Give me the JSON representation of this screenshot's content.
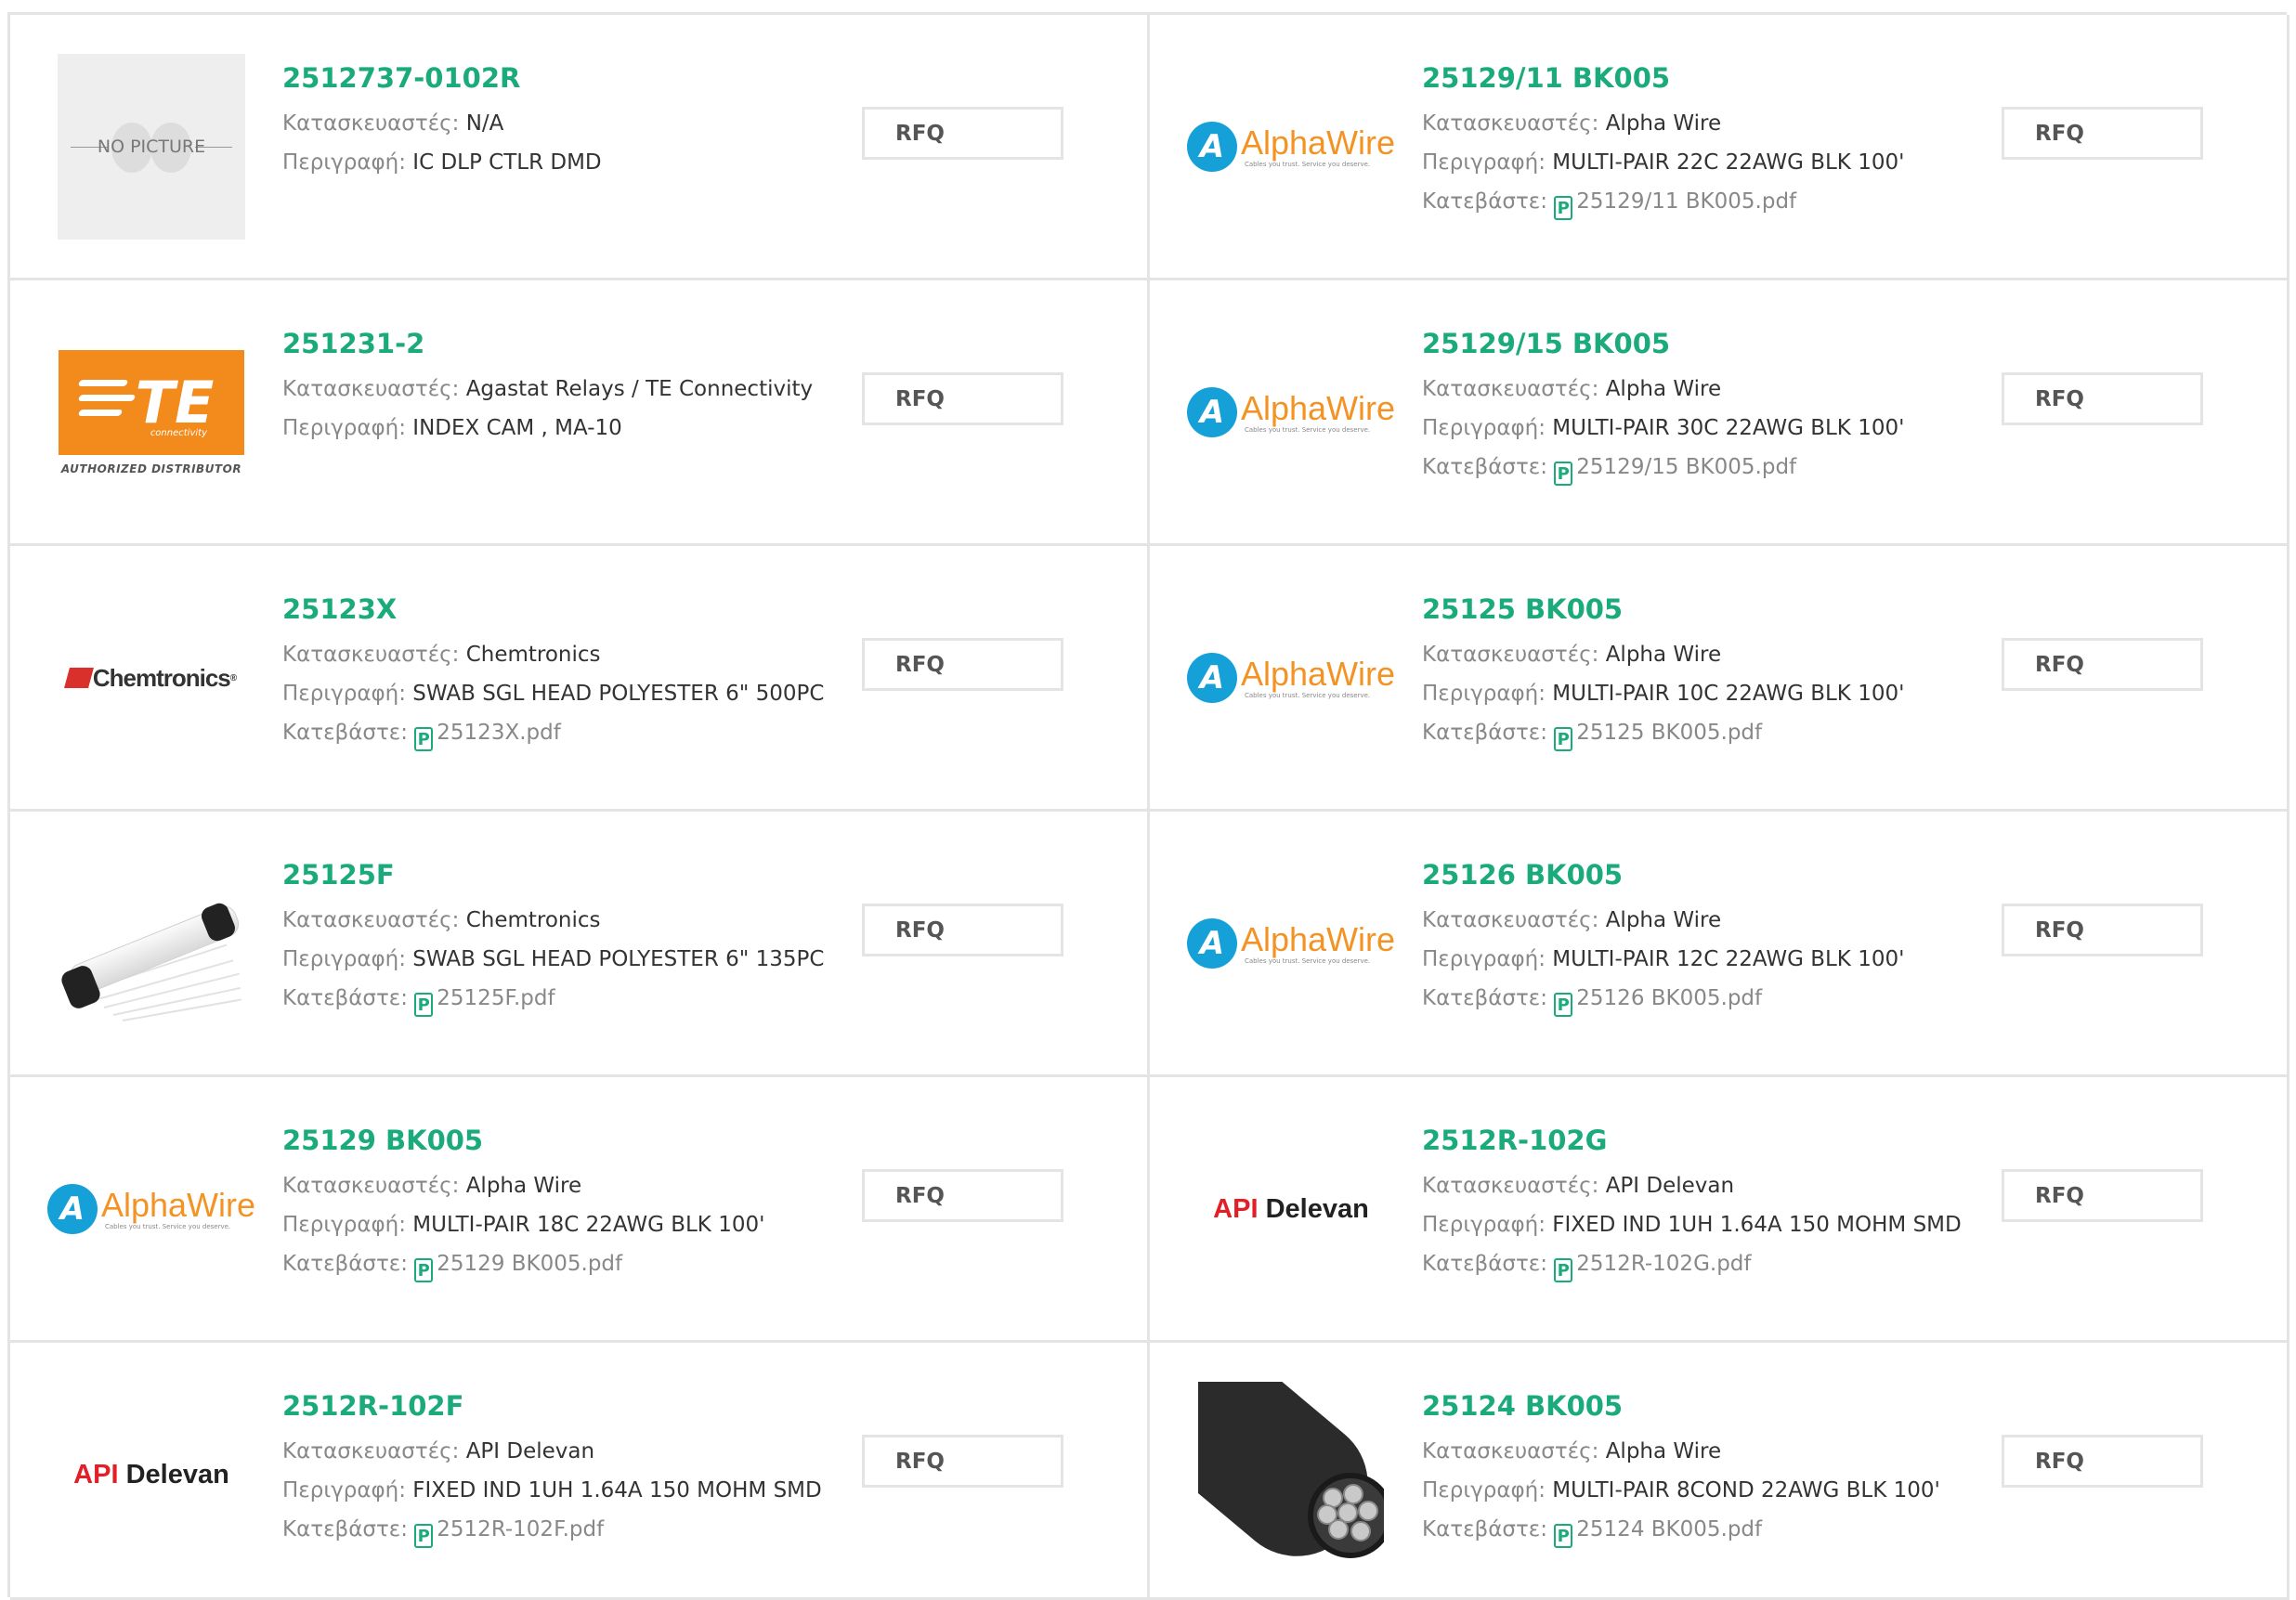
{
  "labels": {
    "manufacturer": "Κατασκευαστές:",
    "description": "Περιγραφή:",
    "download": "Κατεβάστε:",
    "rfq": "RFQ",
    "pdf_icon": "P"
  },
  "logos": {
    "no_picture": "NO PICTURE",
    "te": "TE",
    "te_sub": "connectivity",
    "te_authorized": "AUTHORIZED DISTRIBUTOR",
    "chemtronics": "Chemtronics",
    "chemtronics_mark": "®",
    "alpha_letter": "A",
    "alphawire": "AlphaWire",
    "alphawire_tagline": "Cables you trust. Service you deserve.",
    "api_red": "API",
    "api_dark": "Delevan"
  },
  "colors": {
    "accent": "#1aaa7c",
    "border": "#e4e4e4",
    "label": "#888888",
    "te_orange": "#f28a1c",
    "alpha_blue": "#15a1d8",
    "alpha_orange": "#f39323",
    "api_red": "#e21f26"
  },
  "products": [
    {
      "part": "2512737-0102R",
      "manufacturer": "N/A",
      "description": "IC DLP CTLR DMD",
      "pdf": null,
      "image": "no-picture"
    },
    {
      "part": "25129/11 BK005",
      "manufacturer": "Alpha Wire",
      "description": "MULTI-PAIR 22C 22AWG BLK 100'",
      "pdf": "25129/11 BK005.pdf",
      "image": "alphawire-logo"
    },
    {
      "part": "251231-2",
      "manufacturer": "Agastat Relays / TE Connectivity",
      "description": "INDEX CAM , MA-10",
      "pdf": null,
      "image": "te-logo"
    },
    {
      "part": "25129/15 BK005",
      "manufacturer": "Alpha Wire",
      "description": "MULTI-PAIR 30C 22AWG BLK 100'",
      "pdf": "25129/15 BK005.pdf",
      "image": "alphawire-logo"
    },
    {
      "part": "25123X",
      "manufacturer": "Chemtronics",
      "description": "SWAB SGL HEAD POLYESTER 6\" 500PC",
      "pdf": "25123X.pdf",
      "image": "chemtronics-logo"
    },
    {
      "part": "25125 BK005",
      "manufacturer": "Alpha Wire",
      "description": "MULTI-PAIR 10C 22AWG BLK 100'",
      "pdf": "25125 BK005.pdf",
      "image": "alphawire-logo"
    },
    {
      "part": "25125F",
      "manufacturer": "Chemtronics",
      "description": "SWAB SGL HEAD POLYESTER 6\" 135PC",
      "pdf": "25125F.pdf",
      "image": "swab-photo"
    },
    {
      "part": "25126 BK005",
      "manufacturer": "Alpha Wire",
      "description": "MULTI-PAIR 12C 22AWG BLK 100'",
      "pdf": "25126 BK005.pdf",
      "image": "alphawire-logo"
    },
    {
      "part": "25129 BK005",
      "manufacturer": "Alpha Wire",
      "description": "MULTI-PAIR 18C 22AWG BLK 100'",
      "pdf": "25129 BK005.pdf",
      "image": "alphawire-logo"
    },
    {
      "part": "2512R-102G",
      "manufacturer": "API Delevan",
      "description": "FIXED IND 1UH 1.64A 150 MOHM SMD",
      "pdf": "2512R-102G.pdf",
      "image": "api-delevan-logo"
    },
    {
      "part": "2512R-102F",
      "manufacturer": "API Delevan",
      "description": "FIXED IND 1UH 1.64A 150 MOHM SMD",
      "pdf": "2512R-102F.pdf",
      "image": "api-delevan-logo"
    },
    {
      "part": "25124 BK005",
      "manufacturer": "Alpha Wire",
      "description": "MULTI-PAIR 8COND 22AWG BLK 100'",
      "pdf": "25124 BK005.pdf",
      "image": "cable-photo"
    }
  ]
}
